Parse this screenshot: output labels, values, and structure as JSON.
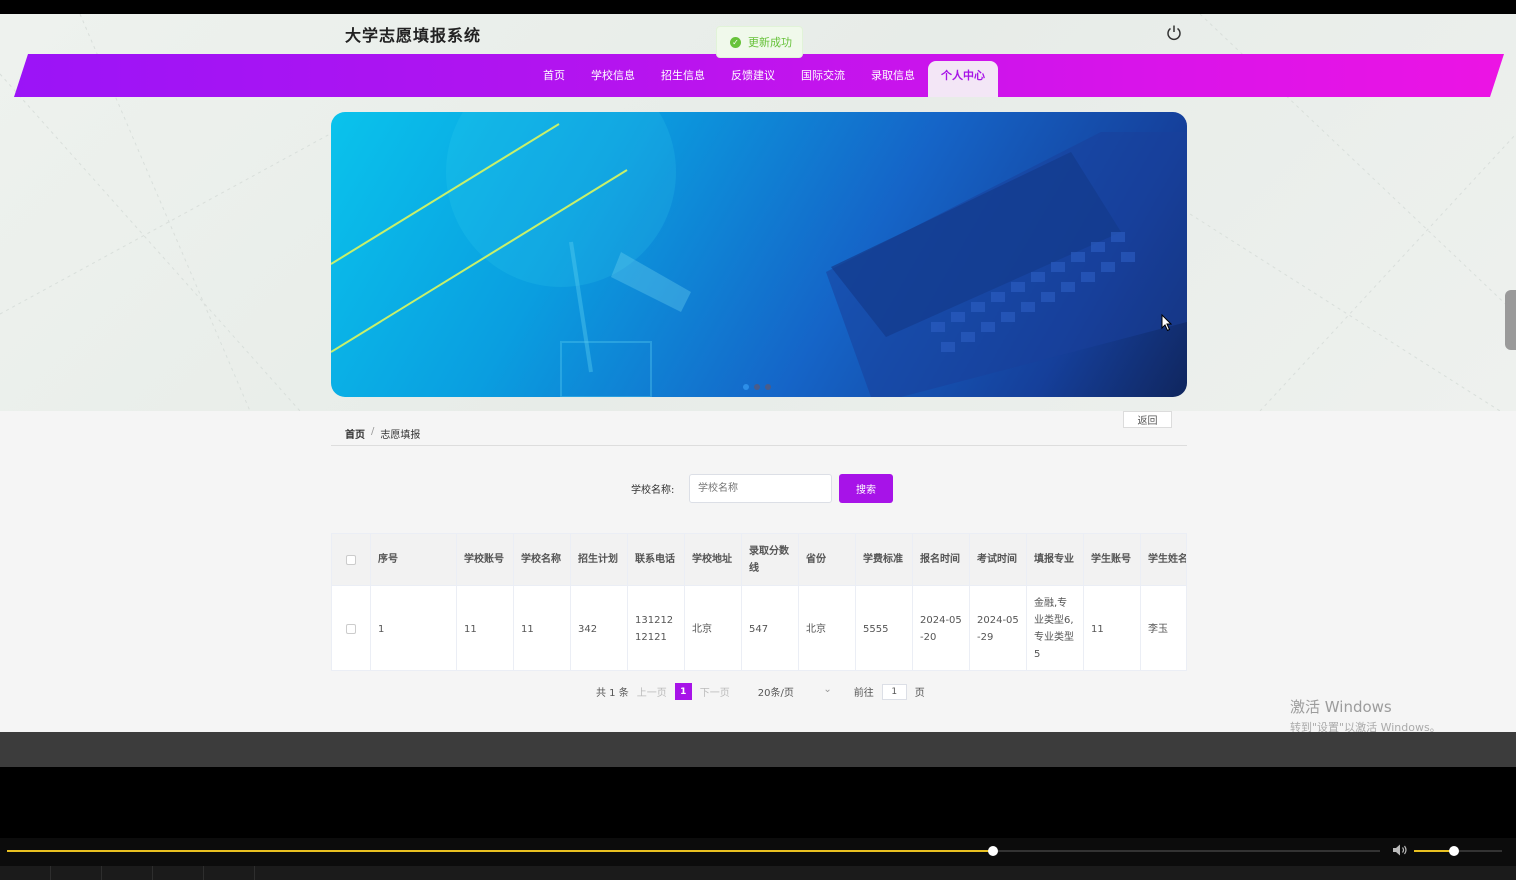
{
  "site": {
    "title": "大学志愿填报系统"
  },
  "toast": {
    "message": "更新成功"
  },
  "nav": {
    "items": [
      "首页",
      "学校信息",
      "招生信息",
      "反馈建议",
      "国际交流",
      "录取信息",
      "个人中心"
    ],
    "active_index": 6
  },
  "carousel": {
    "slide_count": 3,
    "active_slide": 0
  },
  "breadcrumb": {
    "home": "首页",
    "separator": "/",
    "current": "志愿填报"
  },
  "back_button": "返回",
  "search": {
    "label": "学校名称:",
    "placeholder": "学校名称",
    "button": "搜索"
  },
  "table": {
    "columns": [
      "序号",
      "学校账号",
      "学校名称",
      "招生计划",
      "联系电话",
      "学校地址",
      "录取分数线",
      "省份",
      "学费标准",
      "报名时间",
      "考试时间",
      "填报专业",
      "学生账号",
      "学生姓名"
    ],
    "rows": [
      [
        "1",
        "11",
        "11",
        "342",
        "13121212121",
        "北京",
        "547",
        "北京",
        "5555",
        "2024-05-20",
        "2024-05-29",
        "金融,专业类型6,专业类型5",
        "11",
        "李玉"
      ]
    ]
  },
  "pagination": {
    "total": "共 1 条",
    "prev": "上一页",
    "current_page": "1",
    "next": "下一页",
    "page_size": "20条/页",
    "goto_label": "前往",
    "goto_value": "1",
    "page_suffix": "页"
  },
  "watermark": {
    "line1": "激活 Windows",
    "line2": "转到\"设置\"以激活 Windows。"
  },
  "player": {
    "progress": 0.718,
    "volume": 0.45
  },
  "colors": {
    "accent": "#a713e8",
    "nav_start": "#9b14f7",
    "nav_end": "#ec14e4",
    "success": "#67c23a",
    "progress": "#e8c021"
  }
}
